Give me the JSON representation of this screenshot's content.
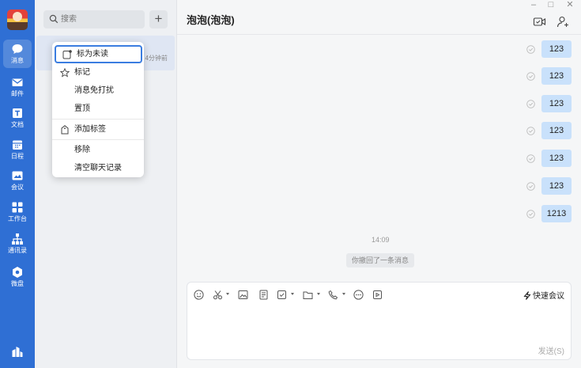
{
  "nav": {
    "items": [
      {
        "label": "消息",
        "icon": "chat-bubble-icon"
      },
      {
        "label": "邮件",
        "icon": "mail-icon"
      },
      {
        "label": "文档",
        "icon": "document-icon"
      },
      {
        "label": "日程",
        "icon": "calendar-icon"
      },
      {
        "label": "会议",
        "icon": "meeting-icon"
      },
      {
        "label": "工作台",
        "icon": "grid-icon"
      },
      {
        "label": "通讯录",
        "icon": "org-chart-icon"
      },
      {
        "label": "微盘",
        "icon": "drive-icon"
      }
    ]
  },
  "search": {
    "placeholder": "搜索"
  },
  "conversation": {
    "time": "4分钟前"
  },
  "context_menu": {
    "items": [
      {
        "label": "标为未读",
        "icon": "mark-unread-icon"
      },
      {
        "label": "标记",
        "icon": "star-icon"
      },
      {
        "label": "消息免打扰",
        "icon": ""
      },
      {
        "label": "置顶",
        "icon": ""
      },
      {
        "label": "添加标签",
        "icon": "tag-icon"
      },
      {
        "label": "移除",
        "icon": ""
      },
      {
        "label": "清空聊天记录",
        "icon": ""
      }
    ]
  },
  "chat": {
    "title": "泡泡(泡泡)",
    "messages": [
      "123",
      "123",
      "123",
      "123",
      "123",
      "123",
      "1213"
    ],
    "time_separator": "14:09",
    "recall_notice": "你撤回了一条消息",
    "quick_meeting": "快速会议",
    "send_label": "发送(S)"
  },
  "colors": {
    "nav_background": "#2f6fd4",
    "bubble": "#c9e1fb",
    "highlight": "#3b7de0"
  }
}
